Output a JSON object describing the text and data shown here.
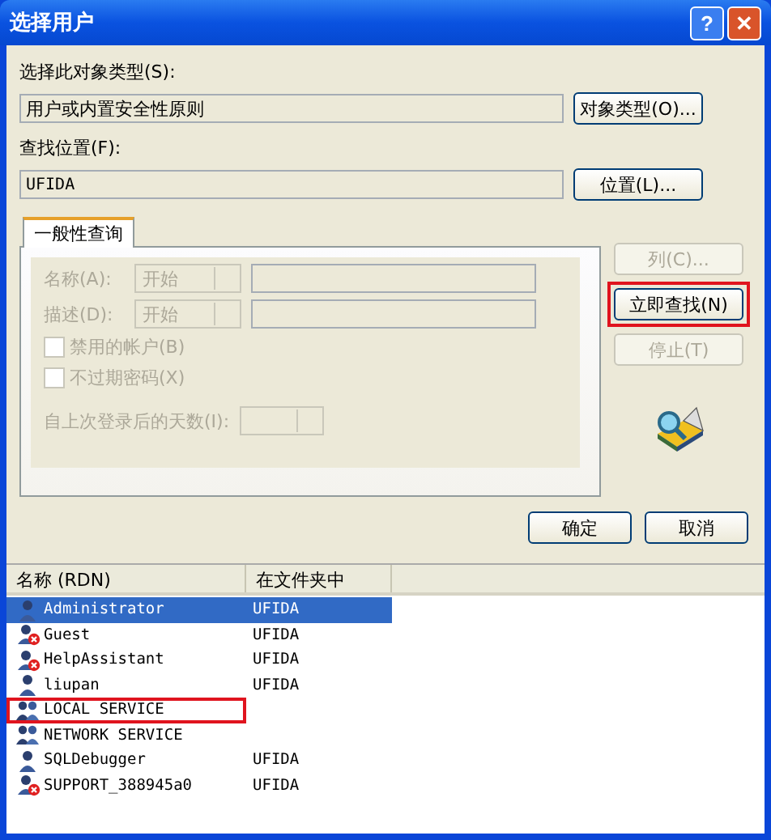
{
  "window": {
    "title": "选择用户",
    "title_buttons": [
      "?",
      "✕"
    ]
  },
  "object_type": {
    "label": "选择此对象类型(S):",
    "value": "用户或内置安全性原则",
    "button": "对象类型(O)..."
  },
  "location": {
    "label": "查找位置(F):",
    "value": "UFIDA",
    "button": "位置(L)..."
  },
  "tabs": [
    {
      "label": "一般性查询",
      "selected": true
    }
  ],
  "query_rows": [
    {
      "label": "名称(A):",
      "combo": "开始",
      "disabled": true
    },
    {
      "label": "描述(D):",
      "combo": "开始",
      "disabled": true
    }
  ],
  "checkboxes": [
    {
      "label": "禁用的帐户(B)",
      "checked": false,
      "disabled": true
    },
    {
      "label": "不过期密码(X)",
      "checked": false,
      "disabled": true
    }
  ],
  "days": {
    "label": "自上次登录后的天数(I):",
    "disabled": true
  },
  "side_buttons": [
    {
      "label": "列(C)...",
      "disabled": true,
      "highlighted": false
    },
    {
      "label": "立即查找(N)",
      "disabled": false,
      "highlighted": true
    },
    {
      "label": "停止(T)",
      "disabled": true,
      "highlighted": false
    }
  ],
  "footer_buttons": [
    "确定",
    "取消"
  ],
  "results": {
    "columns": [
      "名称 (RDN)",
      "在文件夹中"
    ],
    "rows": [
      {
        "name": "Administrator",
        "folder": "UFIDA",
        "kind": "user",
        "selected": true,
        "highlighted": false
      },
      {
        "name": "Guest",
        "folder": "UFIDA",
        "kind": "disabled-user",
        "selected": false,
        "highlighted": false
      },
      {
        "name": "HelpAssistant",
        "folder": "UFIDA",
        "kind": "disabled-user",
        "selected": false,
        "highlighted": false
      },
      {
        "name": "liupan",
        "folder": "UFIDA",
        "kind": "user",
        "selected": false,
        "highlighted": false
      },
      {
        "name": "LOCAL SERVICE",
        "kind": "group",
        "selected": false,
        "highlighted": true
      },
      {
        "name": "NETWORK SERVICE",
        "kind": "group",
        "selected": false,
        "highlighted": false
      },
      {
        "name": "SQLDebugger",
        "folder": "UFIDA",
        "kind": "user",
        "selected": false,
        "highlighted": false
      },
      {
        "name": "SUPPORT_388945a0",
        "folder": "UFIDA",
        "kind": "disabled-user",
        "selected": false,
        "highlighted": false
      }
    ]
  }
}
